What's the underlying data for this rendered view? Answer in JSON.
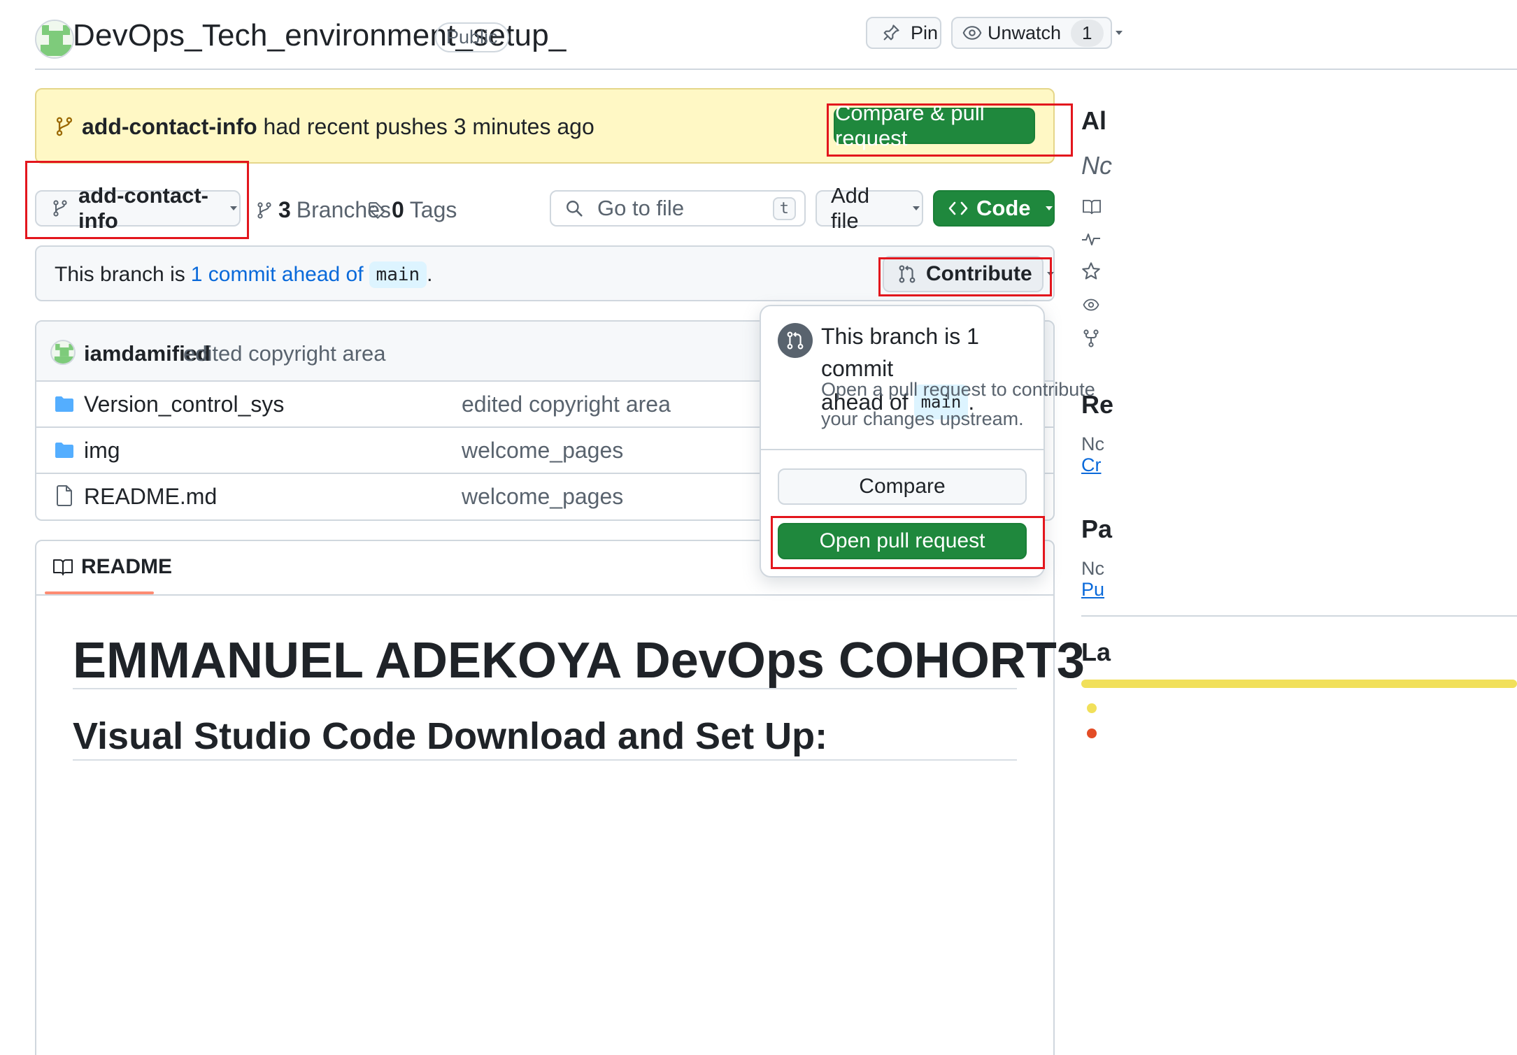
{
  "header": {
    "repo_name": "DevOps_Tech_environment_setup_",
    "visibility": "Public",
    "pin_label": "Pin",
    "watch_label": "Unwatch",
    "watch_count": "1"
  },
  "banner": {
    "branch": "add-contact-info",
    "message": "had recent pushes 3 minutes ago",
    "button_label": "Compare & pull request"
  },
  "toolbar": {
    "branch_selector": "add-contact-info",
    "branches_count": "3",
    "branches_label": "Branches",
    "tags_count": "0",
    "tags_label": "Tags",
    "search_placeholder": "Go to file",
    "search_shortcut": "t",
    "add_file_label": "Add file",
    "code_label": "Code"
  },
  "ahead": {
    "prefix": "This branch is",
    "link_text": "1 commit ahead of",
    "base_branch": "main",
    "suffix": ".",
    "contribute_label": "Contribute"
  },
  "commit": {
    "author": "iamdamified",
    "message": "edited copyright area"
  },
  "files": [
    {
      "name": "Version_control_sys",
      "type": "folder",
      "message": "edited copyright area"
    },
    {
      "name": "img",
      "type": "folder",
      "message": "welcome_pages"
    },
    {
      "name": "README.md",
      "type": "file",
      "message": "welcome_pages"
    }
  ],
  "readme": {
    "tab_label": "README",
    "h1": "EMMANUEL ADEKOYA DevOps COHORT3",
    "h2": "Visual Studio Code Download and Set Up:"
  },
  "popover": {
    "title_line1": "This branch is 1 commit",
    "title_line2": "ahead of",
    "base_branch": "main",
    "title_suffix": ".",
    "desc_line1": "Open a pull request to contribute",
    "desc_line2": "your changes upstream.",
    "compare_label": "Compare",
    "open_pr_label": "Open pull request"
  },
  "sidebar": {
    "about_partial": "Al",
    "desc_partial": "Nc",
    "releases_partial": "Re",
    "releases_none_partial": "Nc",
    "releases_link_partial": "Cr",
    "packages_partial": "Pa",
    "packages_none_partial": "Nc",
    "packages_link_partial": "Pu",
    "languages_partial": "La"
  },
  "colors": {
    "primary_green": "#1f883d",
    "highlight_red": "#e3161d",
    "banner_yellow": "#fff8c5",
    "link_blue": "#0969da",
    "folder_blue": "#54aeff"
  }
}
